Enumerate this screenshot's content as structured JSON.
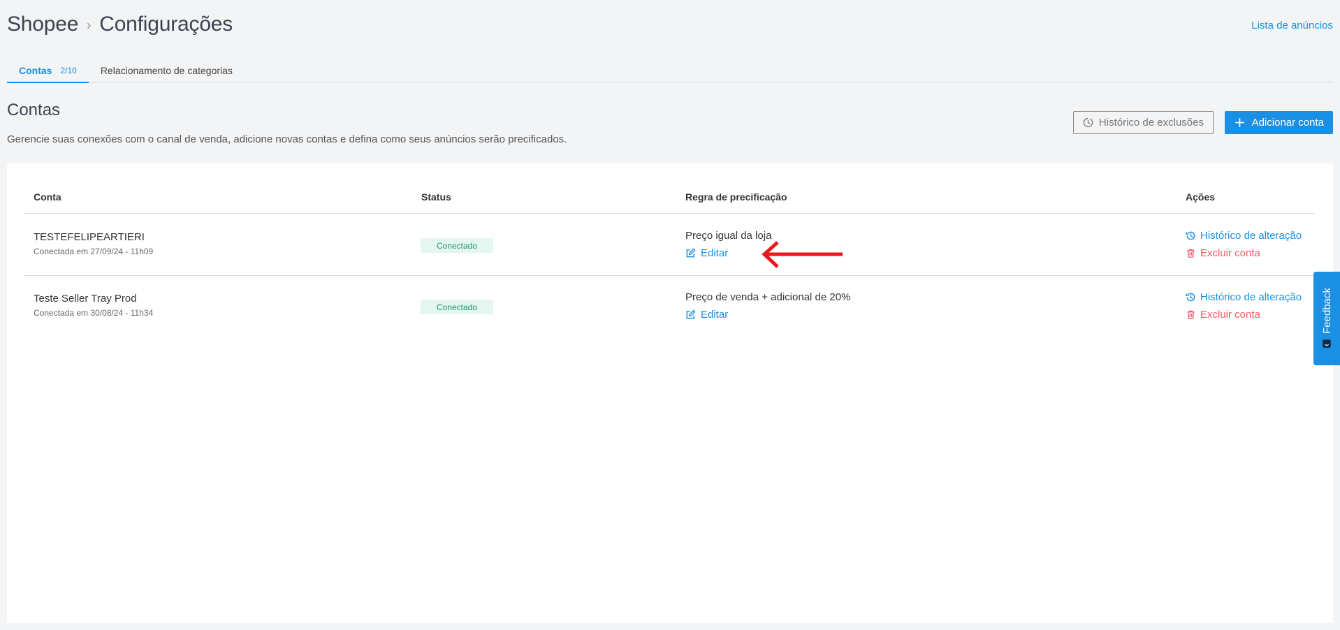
{
  "breadcrumb": {
    "root": "Shopee",
    "separator": "›",
    "current": "Configurações"
  },
  "header_link": "Lista de anúncios",
  "tabs": [
    {
      "label": "Contas",
      "count": "2/10"
    },
    {
      "label": "Relacionamento de categorias"
    }
  ],
  "section": {
    "title": "Contas",
    "description": "Gerencie suas conexões com o canal de venda, adicione novas contas e defina como seus anúncios serão precificados."
  },
  "buttons": {
    "history": "Histórico de exclusões",
    "add": "Adicionar conta"
  },
  "table": {
    "headers": {
      "account": "Conta",
      "status": "Status",
      "rule": "Regra de precificação",
      "actions": "Ações"
    },
    "rows": [
      {
        "name": "TESTEFELIPEARTIERI",
        "connected_at": "Conectada em 27/09/24 - 11h09",
        "status": "Conectado",
        "rule": "Preço igual da loja",
        "edit": "Editar",
        "history": "Histórico de alteração",
        "delete": "Excluir conta"
      },
      {
        "name": "Teste Seller Tray Prod",
        "connected_at": "Conectada em 30/08/24 - 11h34",
        "status": "Conectado",
        "rule": "Preço de venda + adicional de 20%",
        "edit": "Editar",
        "history": "Histórico de alteração",
        "delete": "Excluir conta"
      }
    ]
  },
  "feedback": "Feedback",
  "colors": {
    "accent": "#1a8fe3",
    "danger": "#ef5a64",
    "success": "#1a9a6c",
    "annotation": "#e8171b"
  },
  "icons": [
    "clock-icon",
    "plus-icon",
    "edit-icon",
    "history-icon",
    "trash-icon",
    "arrow-left-icon",
    "feedback-icon"
  ]
}
